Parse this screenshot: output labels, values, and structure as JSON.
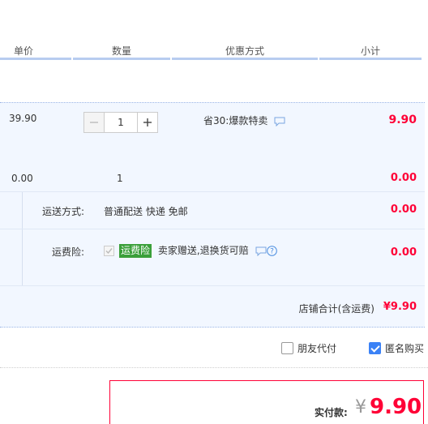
{
  "header": {
    "col_price": "单价",
    "col_qty": "数量",
    "col_promo": "优惠方式",
    "col_subtotal": "小计"
  },
  "item": {
    "price": "39.90",
    "quantity": "1",
    "promo_text": "省30:爆款特卖",
    "subtotal": "9.90",
    "extra_price": "0.00",
    "extra_qty": "1",
    "extra_subtotal": "0.00"
  },
  "shipping": {
    "label": "运送方式:",
    "value": "普通配送 快递 免邮",
    "amount": "0.00"
  },
  "insurance": {
    "label": "运费险:",
    "tag": "运费险",
    "value": "卖家赠送,退换货可赔",
    "amount": "0.00"
  },
  "shop_total": {
    "label": "店铺合计(含运费)",
    "amount": "¥9.90"
  },
  "options": {
    "friend_pay_label": "朋友代付",
    "friend_pay_checked": false,
    "anonymous_label": "匿名购买",
    "anonymous_checked": true
  },
  "payment": {
    "label": "实付款:",
    "currency": "¥",
    "amount": "9.90"
  },
  "colors": {
    "accent_red": "#ff0036",
    "row_bg": "#f2f7ff",
    "header_line": "#b8ccf0",
    "checkbox_blue": "#3b82f6",
    "tag_green": "#3a9f3a"
  },
  "icons": [
    "minus-icon",
    "plus-icon",
    "chat-icon",
    "help-icon",
    "checkbox-icon"
  ]
}
